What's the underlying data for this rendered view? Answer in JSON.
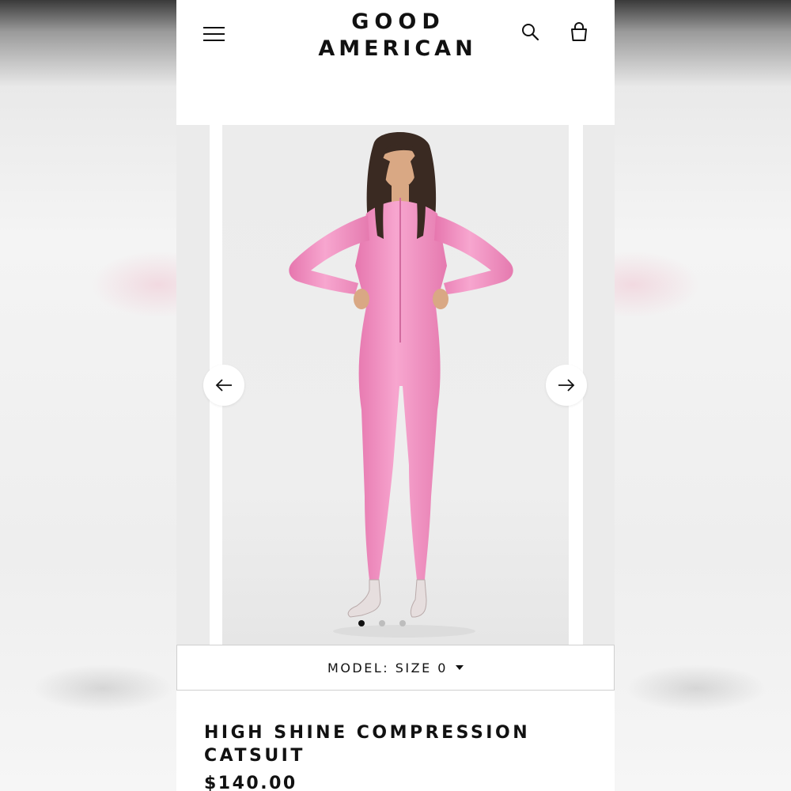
{
  "brand": {
    "line1": "GOOD",
    "line2": "AMERICAN"
  },
  "header": {
    "menu_icon": "hamburger-menu-icon",
    "search_icon": "search-icon",
    "bag_icon": "shopping-bag-icon"
  },
  "carousel": {
    "prev_icon": "arrow-left-icon",
    "next_icon": "arrow-right-icon",
    "dots": 3,
    "active_dot": 1
  },
  "model_size": {
    "label": "MODEL: SIZE 0",
    "icon": "caret-down-icon"
  },
  "product": {
    "title": "HIGH SHINE COMPRESSION CATSUIT",
    "price": "$140.00"
  },
  "colors": {
    "catsuit": "#f28bbf",
    "accent": "#111111",
    "dot_inactive": "#bdbdbd"
  }
}
